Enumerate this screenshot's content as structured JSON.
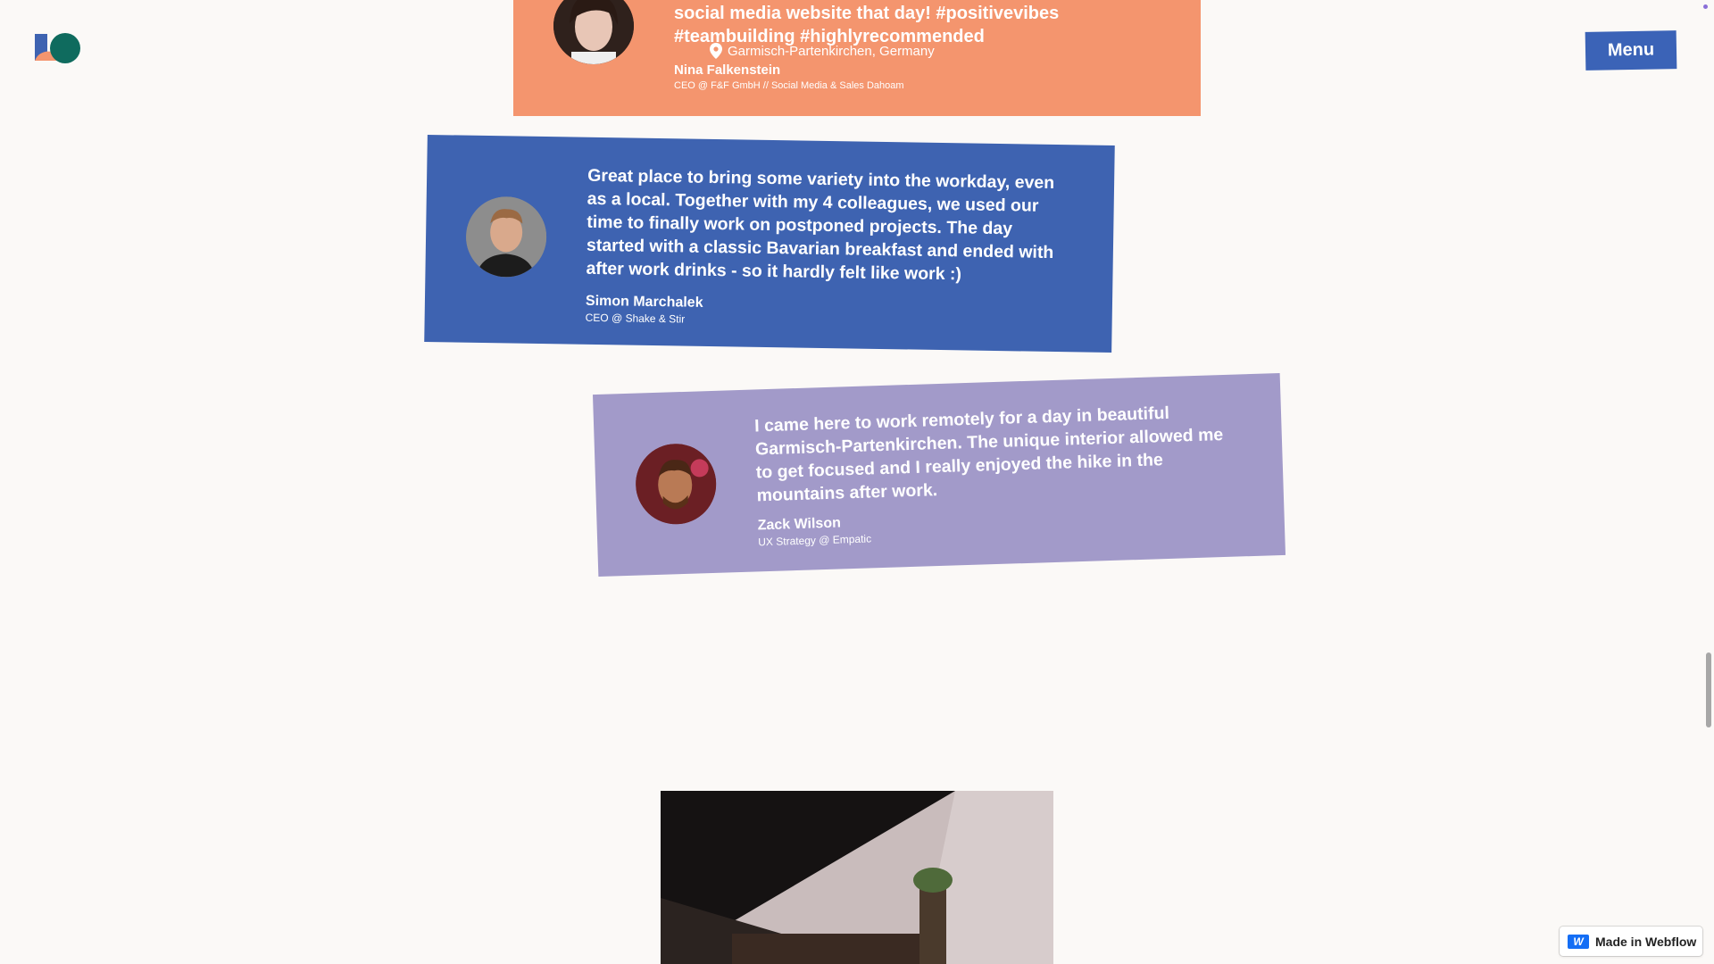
{
  "header": {
    "logo_icon": "studio-logo-icon",
    "menu_label": "Menu",
    "accent_color": "#3b63b7"
  },
  "testimonials": [
    {
      "quote": "social media website that day! #positivevibes #teambuilding #highlyrecommended",
      "location": "Garmisch-Partenkirchen, Germany",
      "name": "Nina Falkenstein",
      "role": "CEO @ F&F GmbH // Social Media & Sales Dahoam",
      "color": "#f4956e"
    },
    {
      "quote": "Great place to bring some variety into the workday, even as a local. Together with my 4 colleagues, we used our time to finally work on postponed projects. The day started with a classic Bavarian breakfast and ended with after work drinks - so it hardly felt like work :)",
      "name": "Simon Marchalek",
      "role": "CEO @ Shake & Stir",
      "color": "#3e63b1"
    },
    {
      "quote": "I came here to work remotely for a day in beautiful Garmisch-Partenkirchen. The unique interior allowed me to get focused and I really enjoyed the hike in the mountains after work.",
      "name": "Zack Wilson",
      "role": "UX Strategy @ Empatic",
      "color": "#a29ac9"
    }
  ],
  "badge": {
    "label": "Made in Webflow",
    "icon": "webflow-logo-icon"
  }
}
